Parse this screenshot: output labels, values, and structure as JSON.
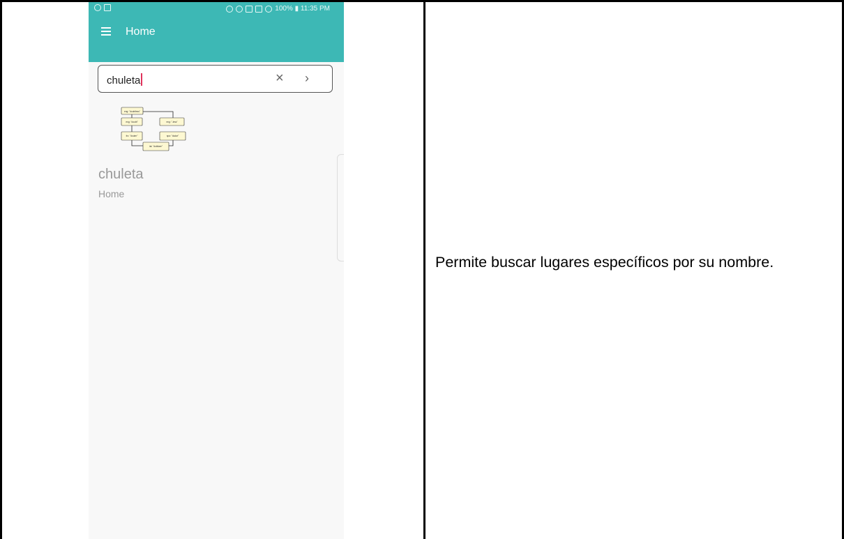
{
  "status_bar": {
    "right_text": "100% ▮ 11:35 PM"
  },
  "app_bar": {
    "title": "Home"
  },
  "search": {
    "value": "chuleta",
    "clear_glyph": "×",
    "go_glyph": "›"
  },
  "thumbnail": {
    "nodes": [
      "eng: \"doubtless\"",
      "eng: \"doubt\"",
      "eng: \"-less\"",
      "fro: \"douter\"",
      "spa: \"dudar\"",
      "lat: \"dubitare\""
    ]
  },
  "result": {
    "title": "chuleta",
    "subtitle": "Home"
  },
  "description": "Permite buscar lugares específicos por su nombre.",
  "colors": {
    "app_bar": "#3db8b5",
    "caret": "#e0335c",
    "node_fill": "#fdf8d2"
  },
  "icons": {
    "menu": "menu-icon",
    "clear": "close-icon",
    "go": "chevron-right-icon"
  }
}
